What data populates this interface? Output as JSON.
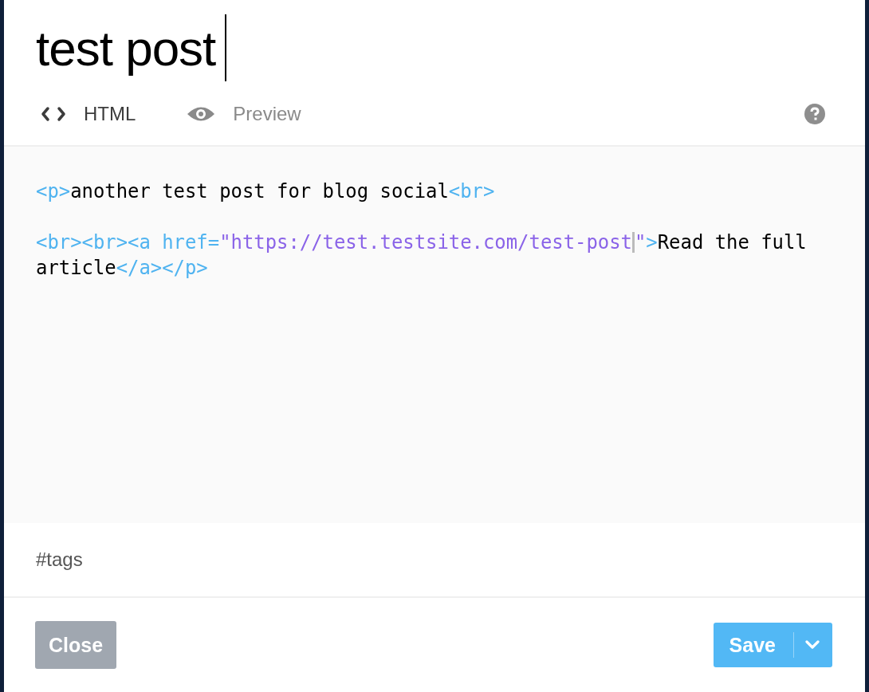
{
  "title": "test post",
  "tabs": [
    {
      "label": "HTML",
      "kind": "code",
      "selected": true
    },
    {
      "label": "Preview",
      "kind": "eye",
      "selected": false
    }
  ],
  "editor": {
    "lines": [
      {
        "kind": "code",
        "tokens": [
          {
            "kind": "tag",
            "text": "<p>"
          },
          {
            "kind": "text",
            "text": "another test post for blog social"
          },
          {
            "kind": "tag",
            "text": "<br>"
          }
        ]
      },
      {
        "kind": "blank"
      },
      {
        "kind": "code",
        "tokens": [
          {
            "kind": "tag",
            "text": "<br><br><a href="
          },
          {
            "kind": "string",
            "text": "\"https://test.testsite.com/test-post"
          },
          {
            "kind": "cursor"
          },
          {
            "kind": "string",
            "text": "\""
          },
          {
            "kind": "tag",
            "text": ">"
          },
          {
            "kind": "text",
            "text": "Read the full article"
          },
          {
            "kind": "tag",
            "text": "</a></p>"
          }
        ]
      }
    ]
  },
  "tags": {
    "placeholder": "#tags"
  },
  "buttons": {
    "close": "Close",
    "save": "Save"
  }
}
